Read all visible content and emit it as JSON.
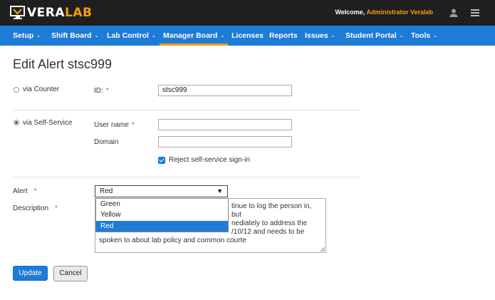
{
  "header": {
    "logo_vera": "VERA",
    "logo_lab": "LAB",
    "welcome_prefix": "Welcome, ",
    "welcome_user": "Administrator Veralab",
    "user_icon": "user-icon",
    "menu_icon": "hamburger-menu-icon",
    "accent_color": "#f39c12"
  },
  "nav": {
    "items": [
      {
        "label": "Setup"
      },
      {
        "label": "Shift Board"
      },
      {
        "label": "Lab Control"
      },
      {
        "label": "Manager Board"
      },
      {
        "label": "Licenses"
      },
      {
        "label": "Reports"
      },
      {
        "label": "Issues"
      },
      {
        "label": "Student Portal"
      },
      {
        "label": "Tools"
      }
    ],
    "active": "Manager Board",
    "caret_glyph": "⌄",
    "bar_color": "#1e7bd6"
  },
  "page": {
    "title": "Edit Alert stsc999"
  },
  "form": {
    "via_counter_label": "via Counter",
    "via_self_service_label": "via Self-Service",
    "selected_mode": "via Self-Service",
    "id_label": "ID:",
    "id_value": "stsc999",
    "username_label": "User name",
    "username_value": "",
    "domain_label": "Domain",
    "domain_value": "",
    "reject_label": "Reject self-service sign-in",
    "reject_checked": true,
    "required_mark": "*",
    "alert_label": "Alert",
    "alert_value": "Red",
    "alert_arrow": "▼",
    "alert_options": [
      "Green",
      "Yellow",
      "Red"
    ],
    "description_label": "Description",
    "description_lines": [
      "tinue to log the person in, but",
      "nediately to address the",
      "/10/12 and needs to be",
      "spoken to about lab policy and common courte"
    ]
  },
  "buttons": {
    "update_label": "Update",
    "cancel_label": "Cancel"
  }
}
